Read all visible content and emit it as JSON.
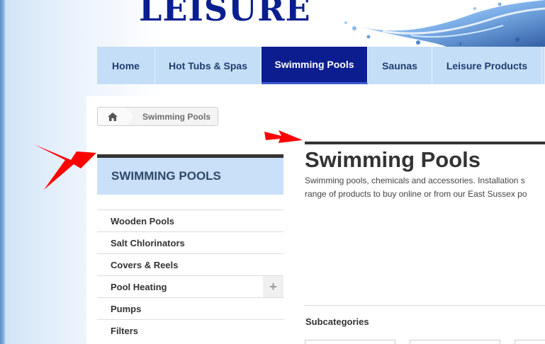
{
  "header": {
    "logo_text": "LEISURE"
  },
  "nav": {
    "items": [
      {
        "label": "Home",
        "active": false
      },
      {
        "label": "Hot Tubs & Spas",
        "active": false
      },
      {
        "label": "Swimming Pools",
        "active": true
      },
      {
        "label": "Saunas",
        "active": false
      },
      {
        "label": "Leisure Products",
        "active": false
      }
    ]
  },
  "breadcrumb": {
    "home_icon": "home-icon",
    "current": "Swimming Pools"
  },
  "sidebar": {
    "heading": "SWIMMING POOLS",
    "items": [
      {
        "label": "Wooden Pools",
        "expandable": false
      },
      {
        "label": "Salt Chlorinators",
        "expandable": false
      },
      {
        "label": "Covers & Reels",
        "expandable": false
      },
      {
        "label": "Pool Heating",
        "expandable": true
      },
      {
        "label": "Pumps",
        "expandable": false
      },
      {
        "label": "Filters",
        "expandable": false
      }
    ],
    "expand_icon": "plus-icon"
  },
  "main": {
    "title": "Swimming Pools",
    "description_line1": "Swimming pools, chemicals and accessories. Installation s",
    "description_line2": "range of products to buy online or from our East Sussex po",
    "subcategories_title": "Subcategories"
  },
  "annotations": {
    "arrow_color": "#ff0000"
  },
  "colors": {
    "nav_bg": "#c5def7",
    "nav_active": "#0c1d8f",
    "sidebar_head_bg": "#c9e0f8"
  }
}
